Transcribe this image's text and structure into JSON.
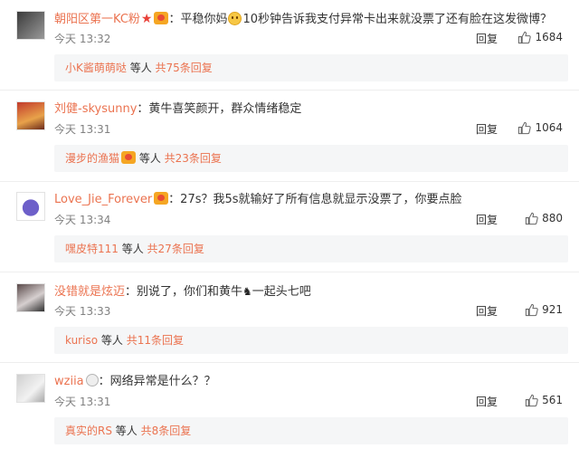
{
  "colors": {
    "username": "#eb7350",
    "subbox_bg": "#f5f6f7",
    "text": "#333333",
    "muted": "#808080"
  },
  "comments": [
    {
      "user": "朝阳区第一KC粉",
      "badges": [
        "star-icon",
        "vip-icon"
      ],
      "text_a": "：平稳你妈",
      "text_b": "10秒钟告诉我支付异常卡出来就没票了还有脸在这发微博？",
      "time": "今天 13:32",
      "reply": "回复",
      "likes": "1684",
      "sub_user": "小K酱萌萌哒",
      "sub_mid": " 等人 ",
      "sub_count": "共75条回复"
    },
    {
      "user": "刘健-skysunny",
      "text_a": "：黄牛喜笑颜开，群众情绪稳定",
      "time": "今天 13:31",
      "reply": "回复",
      "likes": "1064",
      "sub_user": "漫步的渔猫",
      "sub_mid": " 等人 ",
      "sub_count": "共23条回复"
    },
    {
      "user": "Love_Jie_Forever",
      "text_a": "：27s？我5s就输好了所有信息就显示没票了，你要点脸",
      "time": "今天 13:34",
      "reply": "回复",
      "likes": "880",
      "sub_user": "嘿皮特111",
      "sub_mid": " 等人 ",
      "sub_count": "共27条回复"
    },
    {
      "user": "没错就是炫迈",
      "text_a": "：别说了，你们和黄牛",
      "text_b": "一起头七吧",
      "time": "今天 13:33",
      "reply": "回复",
      "likes": "921",
      "sub_user": "kuriso",
      "sub_mid": " 等人 ",
      "sub_count": "共11条回复"
    },
    {
      "user": "wziia",
      "text_a": "：网络异常是什么？？",
      "time": "今天 13:31",
      "reply": "回复",
      "likes": "561",
      "sub_user": "真实的RS",
      "sub_mid": " 等人 ",
      "sub_count": "共8条回复"
    }
  ]
}
